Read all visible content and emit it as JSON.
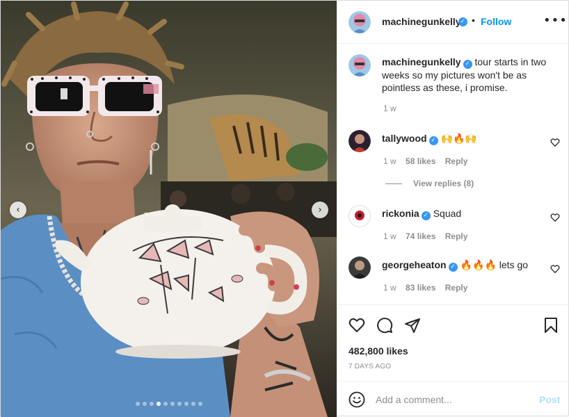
{
  "post": {
    "author": "machinegunkelly",
    "follow_label": "Follow",
    "separator": "•",
    "more_label": "•••",
    "verified_glyph": "✓"
  },
  "caption": {
    "username": "machinegunkelly",
    "text": "tour starts in two weeks so my pictures won't be as pointless as these, i promise.",
    "time": "1 w"
  },
  "comments": [
    {
      "username": "tallywood",
      "text": "🙌🔥🙌",
      "time": "1 w",
      "likes": "58 likes",
      "reply": "Reply"
    },
    {
      "username": "rickonia",
      "text": "Squad",
      "time": "1 w",
      "likes": "74 likes",
      "reply": "Reply"
    },
    {
      "username": "georgeheaton",
      "text": "🔥🔥🔥 lets go",
      "time": "1 w",
      "likes": "83 likes",
      "reply": "Reply"
    }
  ],
  "view_replies": "View replies (8)",
  "likes_count": "482,800 likes",
  "posted_ago": "7 DAYS AGO",
  "add_comment": {
    "placeholder": "Add a comment...",
    "post_label": "Post"
  },
  "carousel": {
    "total_slides": 10,
    "active_slide": 4,
    "prev_glyph": "‹",
    "next_glyph": "›"
  },
  "icons": [
    "heart-icon",
    "comment-icon",
    "share-icon",
    "bookmark-icon",
    "emoji-icon",
    "more-icon",
    "verified-icon"
  ],
  "colors": {
    "accent": "#0095f6",
    "verified": "#3897f0",
    "muted": "#8e8e8e",
    "text": "#262626",
    "post_disabled": "#b2dffc",
    "sweater": "#5b8fc4"
  }
}
